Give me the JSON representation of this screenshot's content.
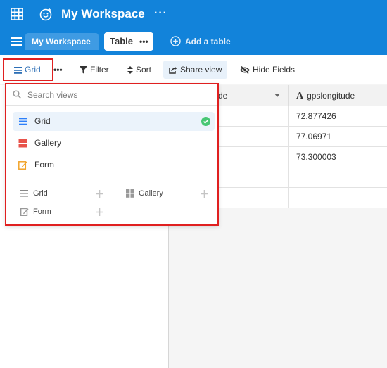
{
  "header": {
    "workspace_title": "My Workspace",
    "more_glyph": "···",
    "apps_icon": "grid-icon",
    "emoji_icon": "smiley-icon",
    "brand_color": "#1283da"
  },
  "tabs": {
    "menu_icon": "hamburger-icon",
    "workspace_tab": "My Workspace",
    "table_tab": "Table",
    "table_tab_more": "•••",
    "add_table": "Add a table"
  },
  "toolbar": {
    "grid_label": "Grid",
    "more_glyph": "•••",
    "filter_label": "Filter",
    "sort_label": "Sort",
    "share_label": "Share view",
    "hide_label": "Hide Fields"
  },
  "table": {
    "columns": [
      {
        "label": "de"
      },
      {
        "label": "gpslongitude",
        "type_icon": "A"
      }
    ],
    "rows": [
      [
        "",
        "72.877426"
      ],
      [
        "",
        "77.06971"
      ],
      [
        "",
        "73.300003"
      ],
      [
        "",
        ""
      ],
      [
        "",
        ""
      ]
    ]
  },
  "view_menu": {
    "search_placeholder": "Search views",
    "views": [
      {
        "label": "Grid",
        "icon": "grid-view-icon",
        "active": true
      },
      {
        "label": "Gallery",
        "icon": "gallery-view-icon",
        "active": false
      },
      {
        "label": "Form",
        "icon": "form-view-icon",
        "active": false
      }
    ],
    "create": [
      {
        "label": "Grid",
        "icon": "grid-view-icon"
      },
      {
        "label": "Gallery",
        "icon": "gallery-view-icon"
      },
      {
        "label": "Form",
        "icon": "form-view-icon"
      }
    ],
    "accent_color": "#e02020",
    "check_color": "#20c933"
  }
}
